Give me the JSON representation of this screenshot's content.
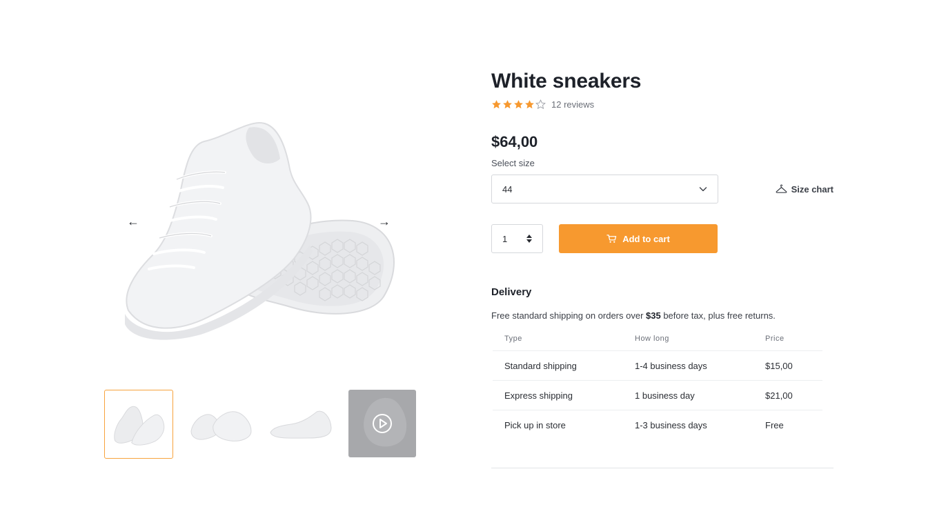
{
  "gallery": {
    "prev_arrow": "←",
    "next_arrow": "→",
    "thumbnails": [
      {
        "kind": "image",
        "active": true
      },
      {
        "kind": "image",
        "active": false
      },
      {
        "kind": "image",
        "active": false
      },
      {
        "kind": "video",
        "active": false
      }
    ]
  },
  "product": {
    "title": "White sneakers",
    "rating": 4,
    "rating_max": 5,
    "reviews": "12 reviews",
    "price": "$64,00",
    "size_label": "Select size",
    "size_selected": "44",
    "size_chart_label": "Size chart",
    "quantity": "1",
    "add_to_cart_label": "Add to cart"
  },
  "delivery": {
    "title": "Delivery",
    "text_before": "Free standard shipping on orders over ",
    "text_bold": "$35",
    "text_after": " before tax, plus free returns.",
    "columns": [
      "Type",
      "How long",
      "Price"
    ],
    "rows": [
      [
        "Standard shipping",
        "1-4 business days",
        "$15,00"
      ],
      [
        "Express shipping",
        "1 business day",
        "$21,00"
      ],
      [
        "Pick up in store",
        "1-3 business days",
        "Free"
      ]
    ]
  },
  "colors": {
    "accent": "#f7992f",
    "star": "#f7992f",
    "thumb_active_border": "#f7a23b",
    "text": "#1d2129"
  },
  "icons": [
    "arrow-left-icon",
    "arrow-right-icon",
    "play-icon",
    "star-icon",
    "chevron-down-icon",
    "hanger-icon",
    "spinner-icon",
    "cart-icon"
  ]
}
